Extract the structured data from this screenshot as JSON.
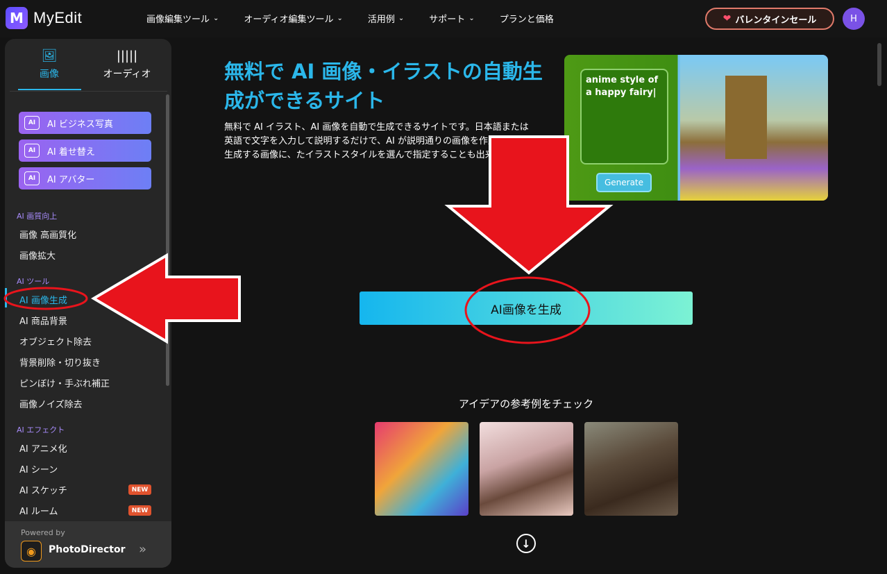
{
  "app": {
    "name": "MyEdit",
    "logo_letter": "M"
  },
  "nav": {
    "items": [
      "画像編集ツール",
      "オーディオ編集ツール",
      "活用例",
      "サポート",
      "プランと価格"
    ],
    "sale_label": "バレンタインセール",
    "avatar_letter": "H"
  },
  "sidebar": {
    "tabs": [
      {
        "label": "画像"
      },
      {
        "label": "オーディオ"
      }
    ],
    "feature_buttons": [
      "AI ビジネス写真",
      "AI 着せ替え",
      "AI アバター"
    ],
    "ai_badge": "AI",
    "sections": [
      {
        "heading": "AI 画質向上",
        "items": [
          "画像 高画質化",
          "画像拡大"
        ]
      },
      {
        "heading": "AI ツール",
        "items": [
          "AI 画像生成",
          "AI 商品背景",
          "オブジェクト除去",
          "背景削除・切り抜き",
          "ピンぼけ・手ぶれ補正",
          "画像ノイズ除去"
        ]
      },
      {
        "heading": "AI エフェクト",
        "items": [
          "AI アニメ化",
          "AI シーン",
          "AI スケッチ",
          "AI ルーム"
        ]
      }
    ],
    "active_item": "AI 画像生成",
    "new_badge": "NEW",
    "footer": {
      "powered_by": "Powered by",
      "product": "PhotoDirector"
    }
  },
  "main": {
    "title": "無料で AI 画像・イラストの自動生成ができるサイト",
    "description": "無料で AI イラスト、AI 画像を自動で生成できるサイトです。日本語または英語で文字を入力して説明するだけで、AI が説明通りの画像を作成します。生成する画像に、たイラストスタイルを選んで指定することも出来ます",
    "hero_prompt": "anime style of a happy fairy|",
    "hero_button": "Generate",
    "generate_button": "AI画像を生成",
    "ideas_title": "アイデアの参考例をチェック"
  },
  "colors": {
    "accent": "#2bb7ea",
    "annotation_red": "#e8141c",
    "new_badge": "#e0532e",
    "section_heading": "#a78bfa"
  }
}
